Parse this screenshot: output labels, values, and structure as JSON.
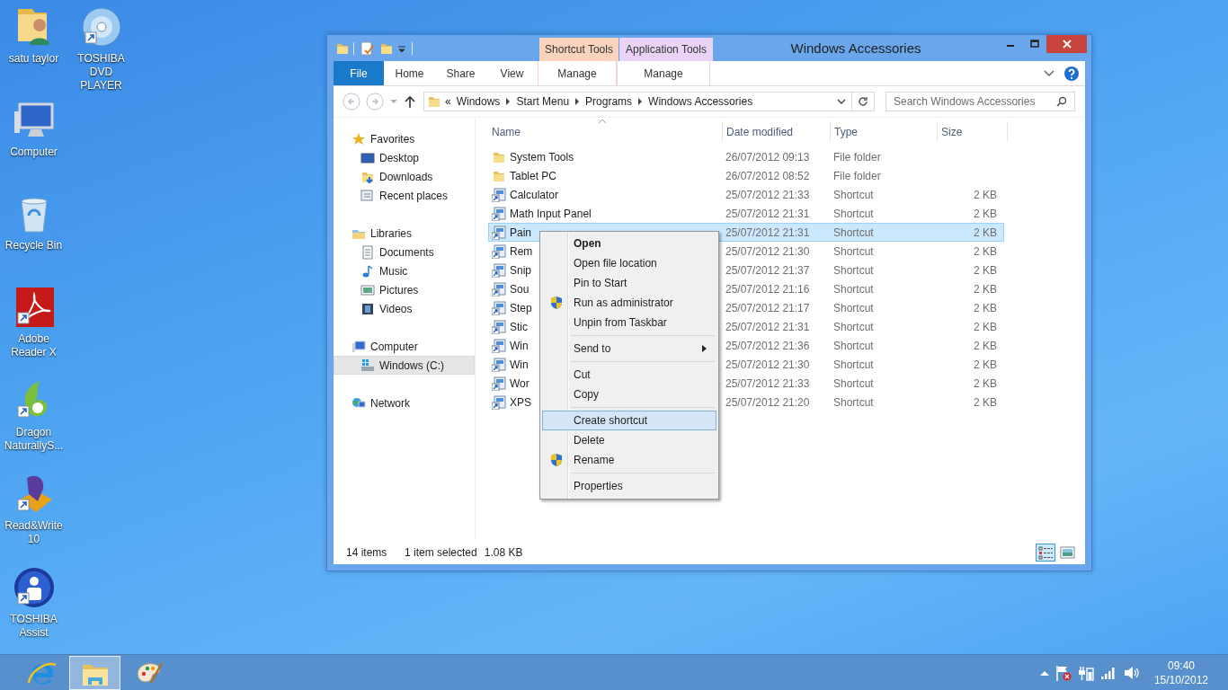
{
  "desktop": {
    "icons": [
      {
        "label": "satu taylor",
        "kind": "user-folder",
        "shortcut": false
      },
      {
        "label": "TOSHIBA DVD PLAYER",
        "kind": "disc",
        "shortcut": true
      },
      {
        "label": "Computer",
        "kind": "computer",
        "shortcut": false
      },
      {
        "label": "Recycle Bin",
        "kind": "bin",
        "shortcut": false
      },
      {
        "label": "Adobe Reader X",
        "kind": "reader",
        "shortcut": true
      },
      {
        "label": "Dragon NaturallyS...",
        "kind": "dragon",
        "shortcut": true
      },
      {
        "label": "Read&Write 10",
        "kind": "readwrite",
        "shortcut": true
      },
      {
        "label": "TOSHIBA Assist",
        "kind": "assist",
        "shortcut": true
      }
    ]
  },
  "window": {
    "title": "Windows Accessories",
    "contextual": [
      {
        "title": "Shortcut Tools",
        "tab": "Manage",
        "color": "#f9d3bd"
      },
      {
        "title": "Application Tools",
        "tab": "Manage",
        "color": "#ebd3f8"
      }
    ],
    "tabs": [
      {
        "label": "File",
        "kind": "file"
      },
      {
        "label": "Home",
        "kind": "plain"
      },
      {
        "label": "Share",
        "kind": "plain"
      },
      {
        "label": "View",
        "kind": "plain"
      }
    ],
    "address": {
      "back_disabled": true,
      "forward_disabled": true,
      "overflow": "«",
      "crumbs": [
        "Windows",
        "Start Menu",
        "Programs",
        "Windows Accessories"
      ],
      "search_placeholder": "Search Windows Accessories"
    },
    "navigation": [
      {
        "label": "Favorites",
        "selected": false,
        "children": [
          {
            "label": "Desktop",
            "selected": false
          },
          {
            "label": "Downloads",
            "selected": false
          },
          {
            "label": "Recent places",
            "selected": false
          }
        ]
      },
      {
        "label": "Libraries",
        "selected": false,
        "children": [
          {
            "label": "Documents",
            "selected": false
          },
          {
            "label": "Music",
            "selected": false
          },
          {
            "label": "Pictures",
            "selected": false
          },
          {
            "label": "Videos",
            "selected": false
          }
        ]
      },
      {
        "label": "Computer",
        "selected": false,
        "children": [
          {
            "label": "Windows (C:)",
            "selected": true
          }
        ]
      },
      {
        "label": "Network",
        "selected": false
      }
    ],
    "columns": [
      {
        "label": "Name",
        "sorted": true
      },
      {
        "label": "Date modified",
        "sorted": false
      },
      {
        "label": "Type",
        "sorted": false
      },
      {
        "label": "Size",
        "sorted": false
      }
    ],
    "files": [
      {
        "name": "System Tools",
        "date": "26/07/2012 09:13",
        "type": "File folder",
        "kind": "folder",
        "selected": false
      },
      {
        "name": "Tablet PC",
        "date": "26/07/2012 08:52",
        "type": "File folder",
        "kind": "folder",
        "selected": false
      },
      {
        "name": "Calculator",
        "date": "25/07/2012 21:33",
        "type": "Shortcut",
        "size": "2 KB",
        "kind": "shortcut",
        "selected": false
      },
      {
        "name": "Math Input Panel",
        "date": "25/07/2012 21:31",
        "type": "Shortcut",
        "size": "2 KB",
        "kind": "shortcut",
        "selected": false
      },
      {
        "name": "Pain",
        "date": "25/07/2012 21:31",
        "type": "Shortcut",
        "size": "2 KB",
        "kind": "shortcut",
        "selected": true
      },
      {
        "name": "Rem",
        "date": "25/07/2012 21:30",
        "type": "Shortcut",
        "size": "2 KB",
        "kind": "shortcut",
        "selected": false
      },
      {
        "name": "Snip",
        "date": "25/07/2012 21:37",
        "type": "Shortcut",
        "size": "2 KB",
        "kind": "shortcut",
        "selected": false
      },
      {
        "name": "Sou",
        "date": "25/07/2012 21:16",
        "type": "Shortcut",
        "size": "2 KB",
        "kind": "shortcut",
        "selected": false
      },
      {
        "name": "Step",
        "date": "25/07/2012 21:17",
        "type": "Shortcut",
        "size": "2 KB",
        "kind": "shortcut",
        "selected": false
      },
      {
        "name": "Stic",
        "date": "25/07/2012 21:31",
        "type": "Shortcut",
        "size": "2 KB",
        "kind": "shortcut",
        "selected": false
      },
      {
        "name": "Win",
        "date": "25/07/2012 21:36",
        "type": "Shortcut",
        "size": "2 KB",
        "kind": "shortcut",
        "selected": false
      },
      {
        "name": "Win",
        "date": "25/07/2012 21:30",
        "type": "Shortcut",
        "size": "2 KB",
        "kind": "shortcut",
        "selected": false
      },
      {
        "name": "Wor",
        "date": "25/07/2012 21:33",
        "type": "Shortcut",
        "size": "2 KB",
        "kind": "shortcut",
        "selected": false
      },
      {
        "name": "XPS",
        "date": "25/07/2012 21:20",
        "type": "Shortcut",
        "size": "2 KB",
        "kind": "shortcut",
        "selected": false
      }
    ],
    "status": {
      "count": "14 items",
      "selection": "1 item selected",
      "size": "1.08 KB",
      "views": [
        {
          "kind": "details",
          "selected": true
        },
        {
          "kind": "large_icons",
          "selected": false
        }
      ]
    }
  },
  "context_menu": {
    "groups": [
      [
        {
          "label": "Open",
          "kind": "plain",
          "default": true,
          "selected": false
        },
        {
          "label": "Open file location",
          "kind": "plain",
          "default": false,
          "selected": false
        },
        {
          "label": "Pin to Start",
          "kind": "plain",
          "default": false,
          "selected": false
        },
        {
          "label": "Run as administrator",
          "kind": "admin",
          "default": false,
          "selected": false
        },
        {
          "label": "Unpin from Taskbar",
          "kind": "plain",
          "default": false,
          "selected": false
        }
      ],
      [
        {
          "label": "Send to",
          "kind": "submenu",
          "default": false,
          "selected": false
        }
      ],
      [
        {
          "label": "Cut",
          "kind": "plain",
          "default": false,
          "selected": false
        },
        {
          "label": "Copy",
          "kind": "plain",
          "default": false,
          "selected": false
        }
      ],
      [
        {
          "label": "Create shortcut",
          "kind": "plain",
          "default": false,
          "selected": true
        },
        {
          "label": "Delete",
          "kind": "plain",
          "default": false,
          "selected": false
        },
        {
          "label": "Rename",
          "kind": "admin",
          "default": false,
          "selected": false
        }
      ],
      [
        {
          "label": "Properties",
          "kind": "plain",
          "default": false,
          "selected": false
        }
      ]
    ]
  },
  "taskbar": {
    "apps": [
      {
        "kind": "browser",
        "active": false
      },
      {
        "kind": "explorer",
        "active": true
      },
      {
        "kind": "paint",
        "active": false
      }
    ],
    "time": "09:40",
    "date": "15/10/2012"
  }
}
